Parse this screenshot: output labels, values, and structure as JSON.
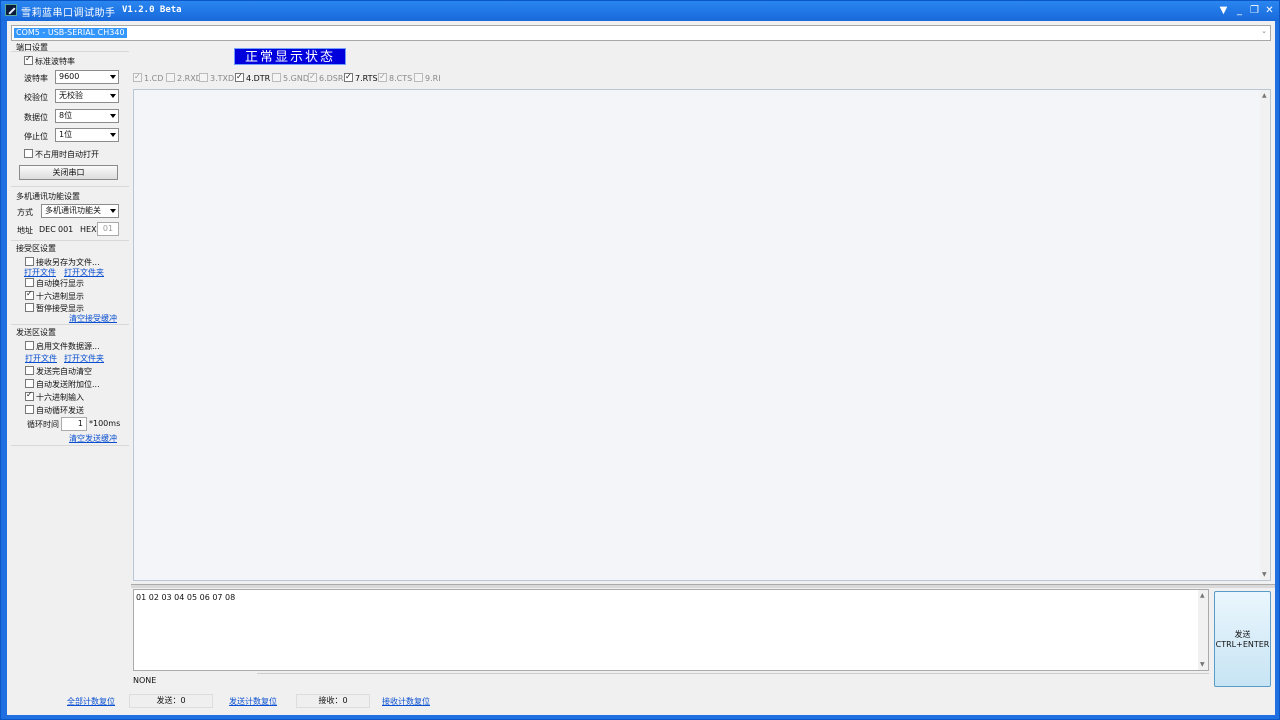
{
  "titlebar": {
    "title": "雪莉蓝串口调试助手",
    "version": "V1.2.0 Beta",
    "controls": [
      "▼",
      "_",
      "❐",
      "✕"
    ]
  },
  "port_select": {
    "value": "COM5 - USB-SERIAL CH340"
  },
  "status_banner": "正常显示状态",
  "port_settings": {
    "title": "端口设置",
    "standard_baud_label": "标准波特率",
    "standard_baud_checked": true,
    "baud_label": "波特率",
    "baud_value": "9600",
    "parity_label": "校验位",
    "parity_value": "无校验",
    "databits_label": "数据位",
    "databits_value": "8位",
    "stopbits_label": "停止位",
    "stopbits_value": "1位",
    "auto_open_label": "不占用时自动打开",
    "auto_open_checked": false,
    "close_port_button": "关闭串口"
  },
  "multi_settings": {
    "title": "多机通讯功能设置",
    "mode_label": "方式",
    "mode_value": "多机通讯功能关",
    "addr_label": "地址",
    "dec_label": "DEC",
    "dec_value": "001",
    "hex_label": "HEX",
    "hex_value": "01"
  },
  "recv_settings": {
    "title": "接受区设置",
    "save_to_file": "接收另存为文件...",
    "open_file": "打开文件",
    "open_folder": "打开文件夹",
    "auto_wrap": "自动换行显示",
    "hex_display": "十六进制显示",
    "pause_display": "暂停接受显示",
    "clear_buffer": "清空接受缓冲"
  },
  "send_settings": {
    "title": "发送区设置",
    "file_source": "启用文件数据源...",
    "open_file": "打开文件",
    "open_folder": "打开文件夹",
    "auto_clear": "发送完自动清空",
    "auto_append": "自动发送附加位...",
    "hex_input": "十六进制输入",
    "auto_loop": "自动循环发送",
    "cycle_label": "循环时间",
    "cycle_value": "1",
    "cycle_unit": "*100ms",
    "clear_buffer": "清空发送缓冲"
  },
  "signals": [
    {
      "label": "1.CD",
      "checked": true,
      "enabled": false
    },
    {
      "label": "2.RXD",
      "checked": false,
      "enabled": false
    },
    {
      "label": "3.TXD",
      "checked": false,
      "enabled": false
    },
    {
      "label": "4.DTR",
      "checked": true,
      "enabled": true
    },
    {
      "label": "5.GND",
      "checked": false,
      "enabled": false
    },
    {
      "label": "6.DSR",
      "checked": true,
      "enabled": false
    },
    {
      "label": "7.RTS",
      "checked": true,
      "enabled": true
    },
    {
      "label": "8.CTS",
      "checked": true,
      "enabled": false
    },
    {
      "label": "9.RI",
      "checked": false,
      "enabled": false
    }
  ],
  "send_box": {
    "text": "01 02 03 04 05 06 07 08"
  },
  "send_button": {
    "line1": "发送",
    "line2": "CTRL+ENTER"
  },
  "status_line": "NONE",
  "bottom": {
    "reset_all": "全部计数复位",
    "sent": "发送：0",
    "reset_sent": "发送计数复位",
    "received": "接收：0",
    "reset_received": "接收计数复位"
  }
}
